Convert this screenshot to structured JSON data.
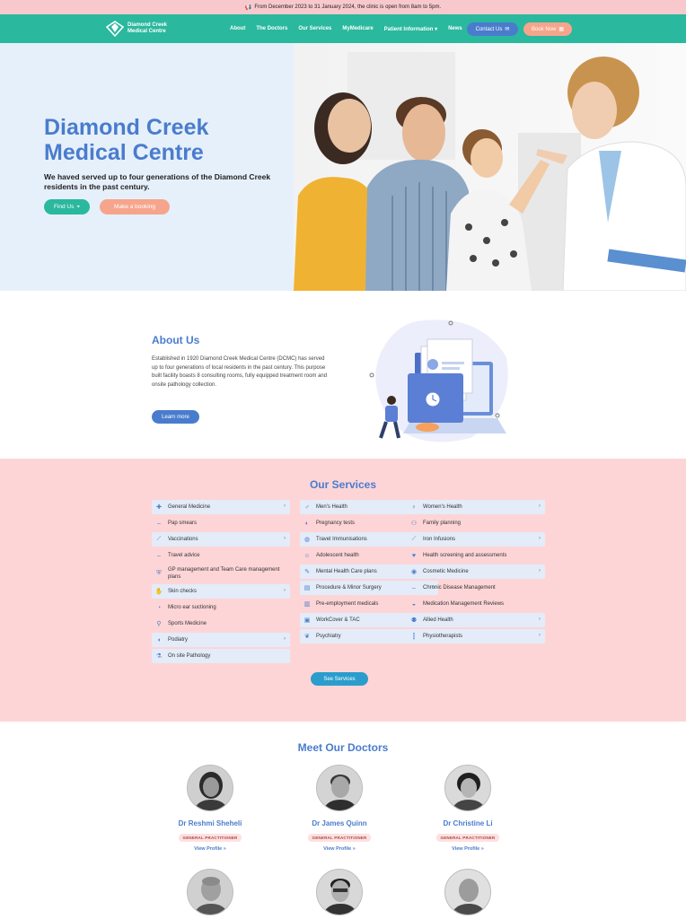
{
  "announcement": "From December 2023 to 31 January 2024, the clinic is open from 8am to 5pm.",
  "brand": {
    "line1": "Diamond Creek",
    "line2": "Medical Centre"
  },
  "nav": {
    "items": [
      "About",
      "The Doctors",
      "Our Services",
      "MyMedicare",
      "Patient Information",
      "News"
    ],
    "contact_label": "Contact Us",
    "book_label": "Book Now"
  },
  "hero": {
    "title_line1": "Diamond Creek",
    "title_line2": "Medical Centre",
    "subtitle": "We haved served up to four generations of the Diamond Creek residents in the past century.",
    "find_label": "Find Us",
    "booking_label": "Make a booking"
  },
  "about": {
    "title": "About Us",
    "text": "Established in 1920 Diamond Creek Medical Centre (DCMC) has served up to four generations of local residents in the past century. This purpose built facility boasts 8 consulting rooms, fully equipped treatment room and onsite pathology collection.",
    "button": "Learn more"
  },
  "services": {
    "title": "Our Services",
    "columns": [
      [
        {
          "label": "General Medicine",
          "icon": "medkit-icon",
          "boxed": true,
          "chevron": true
        },
        {
          "label": "Pap smears",
          "icon": "dash-icon",
          "boxed": false,
          "chevron": false
        },
        {
          "label": "Vaccinations",
          "icon": "syringe-icon",
          "boxed": true,
          "chevron": true
        },
        {
          "label": "Travel advice",
          "icon": "dash-icon",
          "boxed": false,
          "chevron": false
        },
        {
          "label": "GP management and Team Care management plans",
          "icon": "shield-icon",
          "boxed": false,
          "chevron": false
        },
        {
          "label": "Skin checks",
          "icon": "hand-icon",
          "boxed": true,
          "chevron": true
        },
        {
          "label": "Micro ear suctioning",
          "icon": "ear-icon",
          "boxed": false,
          "chevron": false
        },
        {
          "label": "Sports Medicine",
          "icon": "runner-icon",
          "boxed": false,
          "chevron": false
        },
        {
          "label": "Podiatry",
          "icon": "foot-icon",
          "boxed": true,
          "chevron": true
        },
        {
          "label": "On site Pathology",
          "icon": "flask-icon",
          "boxed": true,
          "chevron": false
        }
      ],
      [
        {
          "label": "Men's Health",
          "icon": "male-icon",
          "boxed": true,
          "chevron": true
        },
        {
          "label": "Pregnancy tests",
          "icon": "pregnancy-icon",
          "boxed": false,
          "chevron": false
        },
        {
          "label": "Travel Immunisations",
          "icon": "globe-icon",
          "boxed": true,
          "chevron": true
        },
        {
          "label": "Adolescent health",
          "icon": "child-icon",
          "boxed": false,
          "chevron": false
        },
        {
          "label": "Mental Health Care plans",
          "icon": "chat-icon",
          "boxed": true,
          "chevron": true
        },
        {
          "label": "Procedure & Minor Surgery",
          "icon": "clipboard-icon",
          "boxed": true,
          "chevron": true
        },
        {
          "label": "Pre-employment medicals",
          "icon": "document-icon",
          "boxed": false,
          "chevron": false
        },
        {
          "label": "WorkCover & TAC",
          "icon": "briefcase-icon",
          "boxed": true,
          "chevron": false
        },
        {
          "label": "Psychiatry",
          "icon": "brain-icon",
          "boxed": true,
          "chevron": true
        }
      ],
      [
        {
          "label": "Women's Health",
          "icon": "female-icon",
          "boxed": true,
          "chevron": true
        },
        {
          "label": "Family planning",
          "icon": "family-icon",
          "boxed": false,
          "chevron": false
        },
        {
          "label": "Iron Infusions",
          "icon": "syringe-icon",
          "boxed": true,
          "chevron": true
        },
        {
          "label": "Health screening and assessments",
          "icon": "heart-icon",
          "boxed": false,
          "chevron": false
        },
        {
          "label": "Cosmetic Medicine",
          "icon": "eye-icon",
          "boxed": true,
          "chevron": true
        },
        {
          "label": "Chronic Disease Management",
          "icon": "dash-icon",
          "boxed": false,
          "chevron": false
        },
        {
          "label": "Medication Management Reviews",
          "icon": "pills-icon",
          "boxed": false,
          "chevron": false
        },
        {
          "label": "Allied Health",
          "icon": "users-icon",
          "boxed": true,
          "chevron": true
        },
        {
          "label": "Physiotherapists",
          "icon": "spine-icon",
          "boxed": true,
          "chevron": true
        }
      ]
    ],
    "see_label": "See Services"
  },
  "doctors": {
    "title": "Meet Our Doctors",
    "badge": "GENERAL PRACTITIONER",
    "profile_label": "View Profile »",
    "list": [
      {
        "name": "Dr Reshmi Sheheli"
      },
      {
        "name": "Dr James Quinn"
      },
      {
        "name": "Dr Christine Li"
      }
    ]
  },
  "colors": {
    "accent": "#4a7ccd",
    "teal": "#2ab89e",
    "peach": "#f6a58c",
    "pink": "#fdd5d7"
  }
}
